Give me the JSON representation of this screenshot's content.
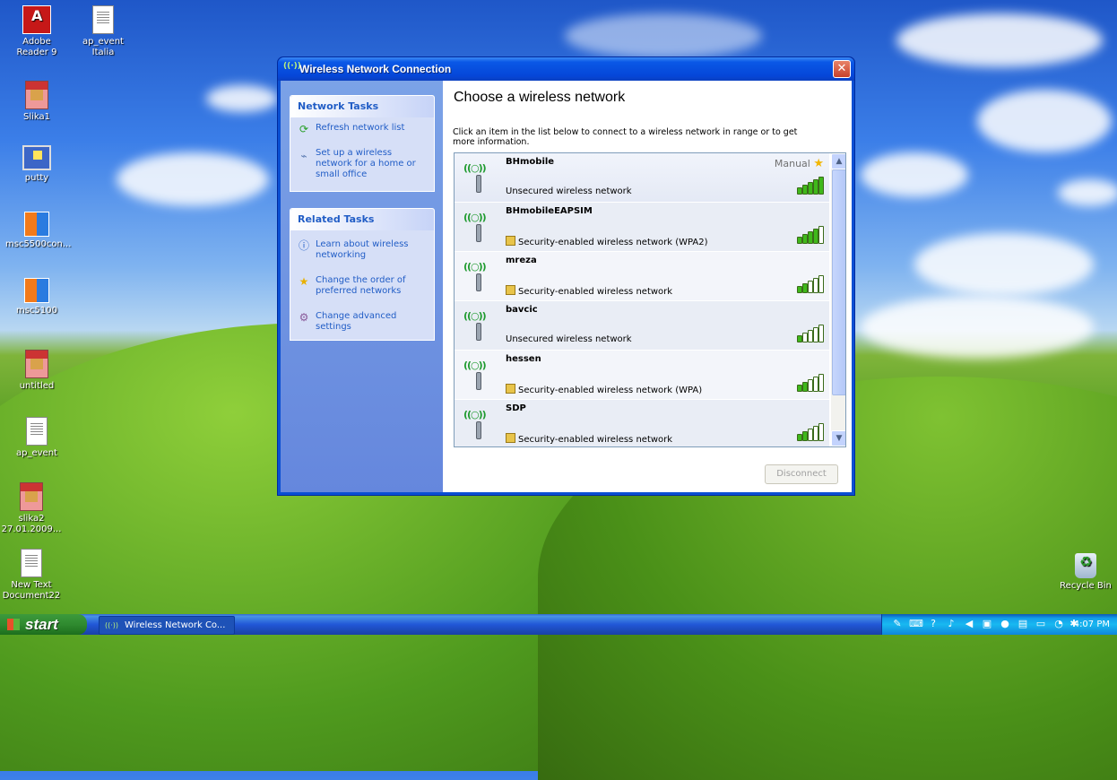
{
  "desktop": {
    "icons": [
      {
        "label": "Adobe Reader 9",
        "icon": "pdf-icon"
      },
      {
        "label": "ap_event Italia",
        "icon": "document-icon"
      },
      {
        "label": "Slika1",
        "icon": "archive-icon"
      },
      {
        "label": "putty",
        "icon": "terminal-icon"
      },
      {
        "label": "msc5500con...",
        "icon": "app-icon"
      },
      {
        "label": "msc5100",
        "icon": "app-icon"
      },
      {
        "label": "untitled",
        "icon": "archive-icon"
      },
      {
        "label": "ap_event",
        "icon": "document-icon"
      },
      {
        "label": "slika2 27.01.2009...",
        "icon": "archive-icon"
      },
      {
        "label": "New Text Document22",
        "icon": "document-icon"
      },
      {
        "label": "Recycle Bin",
        "icon": "recycle-bin-icon"
      }
    ]
  },
  "window": {
    "title": "Wireless Network Connection",
    "title_icon": "((·))",
    "close_glyph": "✕"
  },
  "network_tasks": {
    "heading": "Network Tasks",
    "items": [
      {
        "label": "Refresh network list",
        "icon": "refresh-icon"
      },
      {
        "label": "Set up a wireless network for a home or small office",
        "icon": "wireless-setup-icon"
      }
    ]
  },
  "related_tasks": {
    "heading": "Related Tasks",
    "items": [
      {
        "label": "Learn about wireless networking",
        "icon": "info-icon"
      },
      {
        "label": "Change the order of preferred networks",
        "icon": "star-icon"
      },
      {
        "label": "Change advanced settings",
        "icon": "settings-icon"
      }
    ]
  },
  "main": {
    "heading": "Choose a wireless network",
    "description": "Click an item in the list below to connect to a wireless network in range or to get more information.",
    "manual_label": "Manual",
    "disconnect_label": "Disconnect"
  },
  "networks": [
    {
      "ssid": "BHmobile",
      "security": "Unsecured wireless network",
      "secured": false,
      "signal_bars": 5,
      "manual": true
    },
    {
      "ssid": "BHmobileEAPSIM",
      "security": "Security-enabled wireless network (WPA2)",
      "secured": true,
      "signal_bars": 4,
      "manual": false
    },
    {
      "ssid": "mreza",
      "security": "Security-enabled wireless network",
      "secured": true,
      "signal_bars": 2,
      "manual": false
    },
    {
      "ssid": "bavcic",
      "security": "Unsecured wireless network",
      "secured": false,
      "signal_bars": 1,
      "manual": false
    },
    {
      "ssid": "hessen",
      "security": "Security-enabled wireless network (WPA)",
      "secured": true,
      "signal_bars": 2,
      "manual": false
    },
    {
      "ssid": "SDP",
      "security": "Security-enabled wireless network",
      "secured": true,
      "signal_bars": 2,
      "manual": false
    }
  ],
  "taskbar": {
    "start_label": "start",
    "buttons": [
      {
        "label": "Wireless Network Co...",
        "icon": "((·))"
      }
    ],
    "clock": "4:07 PM"
  },
  "colors": {
    "signal_on": "#3fb81a",
    "signal_off": "#ffffff",
    "link_blue": "#215dc6"
  }
}
